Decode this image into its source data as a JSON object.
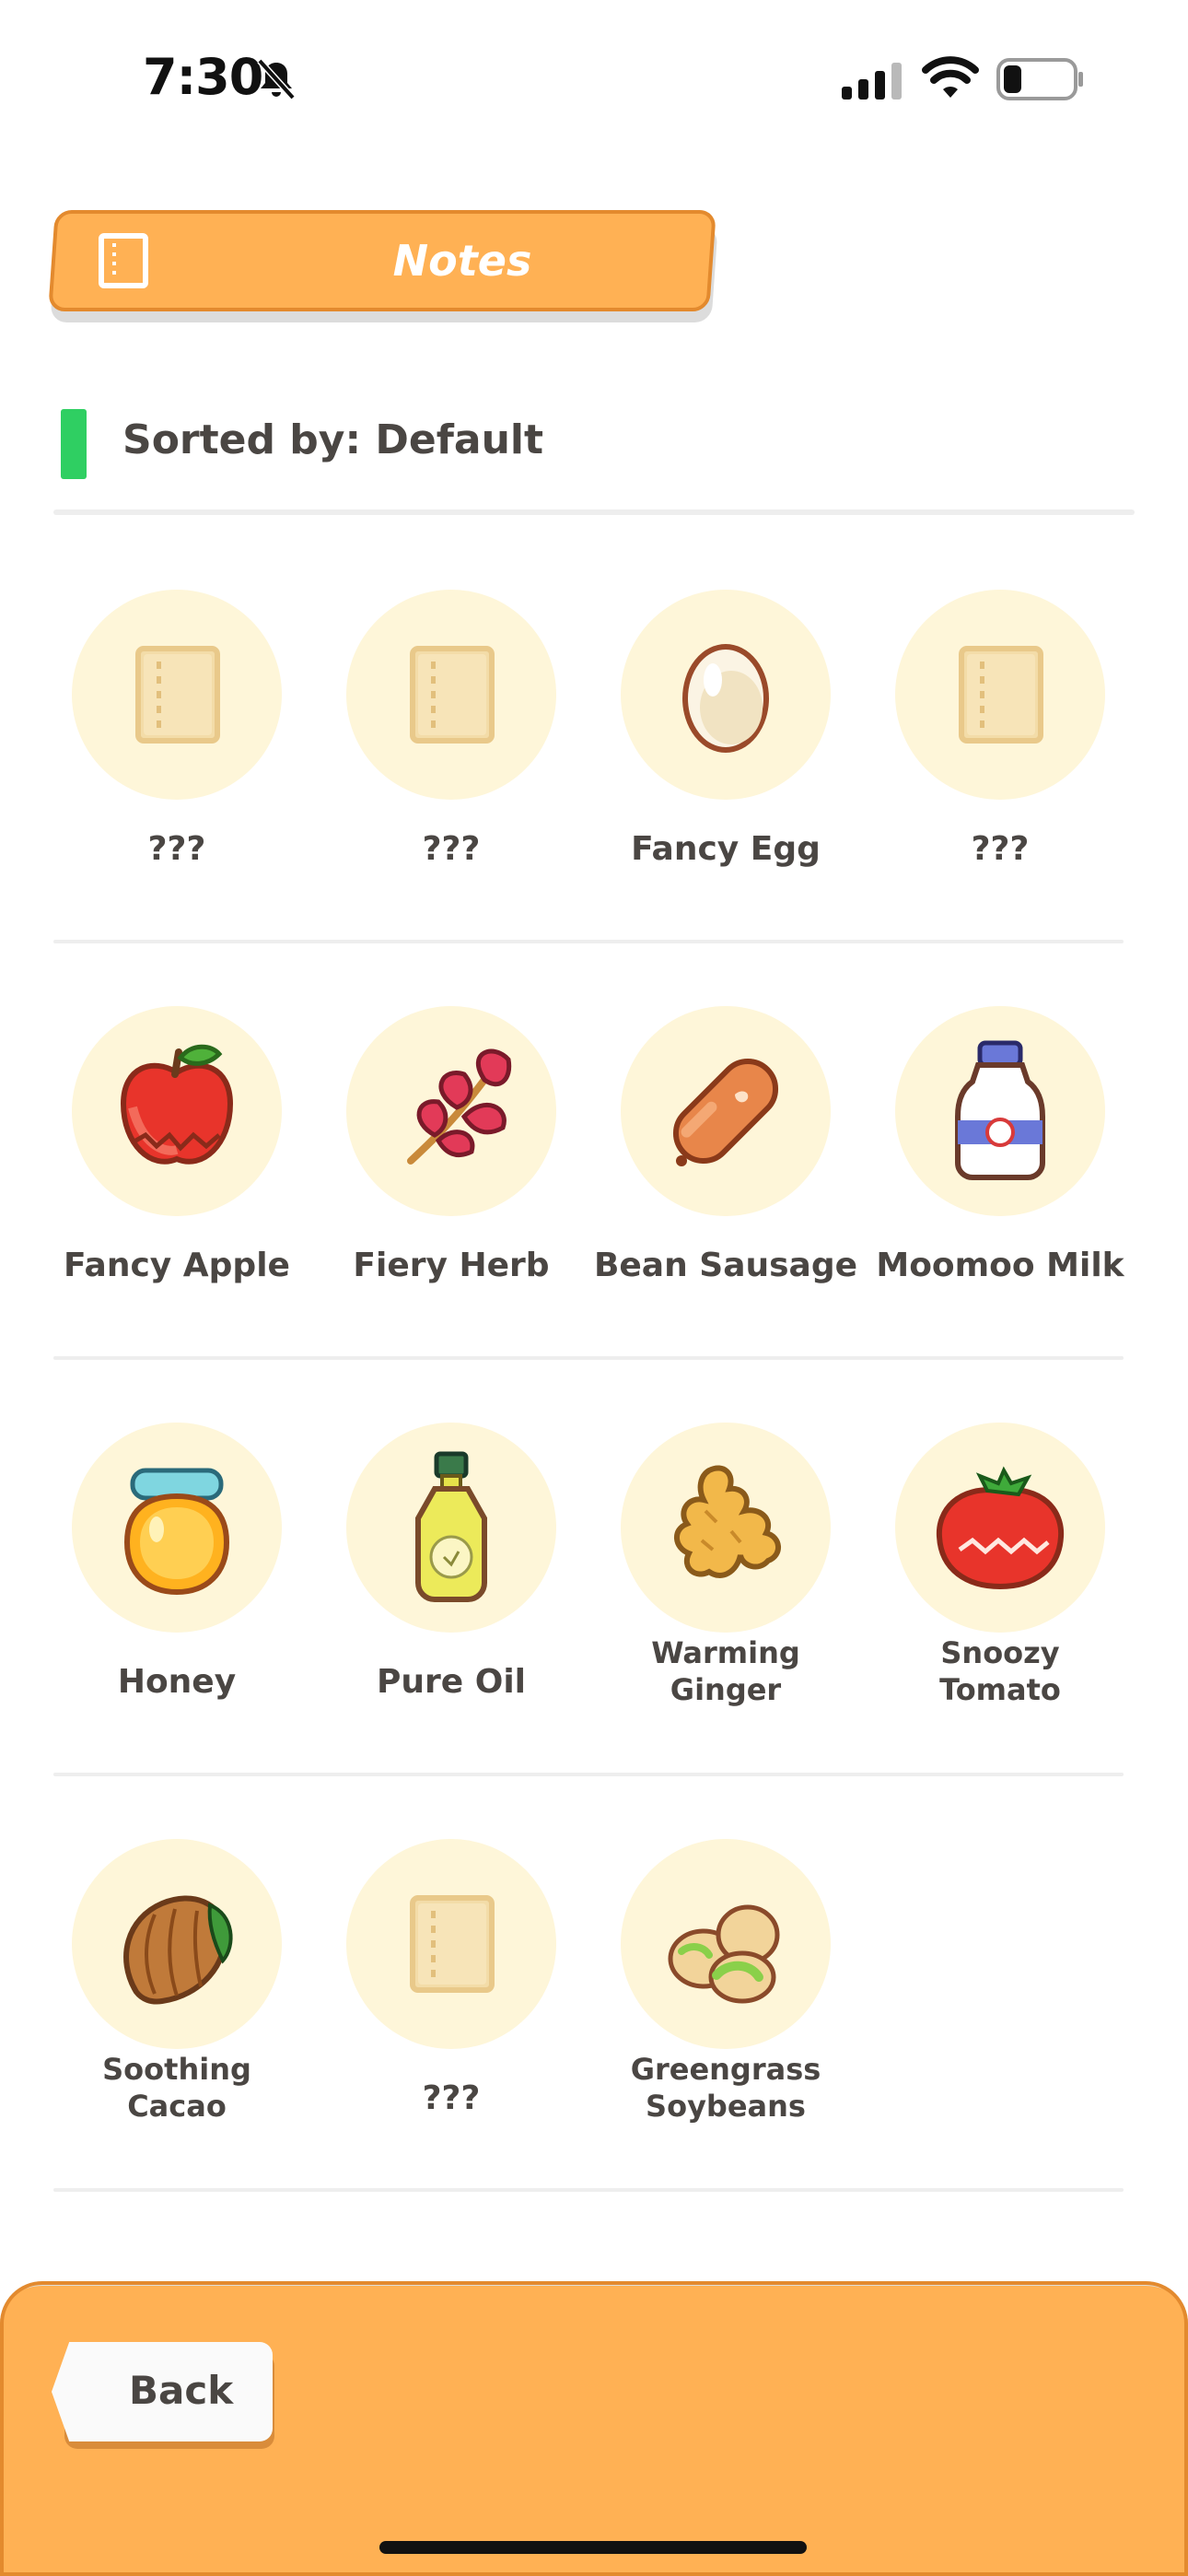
{
  "status_bar": {
    "time": "7:30",
    "battery_level": 0.25
  },
  "header": {
    "title": "Notes"
  },
  "sort": {
    "label": "Sorted by: Default"
  },
  "items": [
    {
      "name": "???",
      "icon": "locked-notebook-icon"
    },
    {
      "name": "???",
      "icon": "locked-notebook-icon"
    },
    {
      "name": "Fancy Egg",
      "icon": "egg-icon"
    },
    {
      "name": "???",
      "icon": "locked-notebook-icon"
    },
    {
      "name": "Fancy Apple",
      "icon": "apple-icon"
    },
    {
      "name": "Fiery Herb",
      "icon": "herb-icon"
    },
    {
      "name": "Bean Sausage",
      "icon": "sausage-icon"
    },
    {
      "name": "Moomoo Milk",
      "icon": "milk-bottle-icon"
    },
    {
      "name": "Honey",
      "icon": "honey-jar-icon"
    },
    {
      "name": "Pure Oil",
      "icon": "oil-bottle-icon"
    },
    {
      "name": "Warming\nGinger",
      "icon": "ginger-icon"
    },
    {
      "name": "Snoozy\nTomato",
      "icon": "tomato-icon"
    },
    {
      "name": "Soothing\nCacao",
      "icon": "cacao-pod-icon"
    },
    {
      "name": "???",
      "icon": "locked-notebook-icon"
    },
    {
      "name": "Greengrass\nSoybeans",
      "icon": "soybeans-icon"
    }
  ],
  "footer": {
    "back_label": "Back"
  },
  "colors": {
    "accent_orange": "#ffb154",
    "sort_marker": "#2fcf62",
    "item_circle": "#fef6d9"
  }
}
